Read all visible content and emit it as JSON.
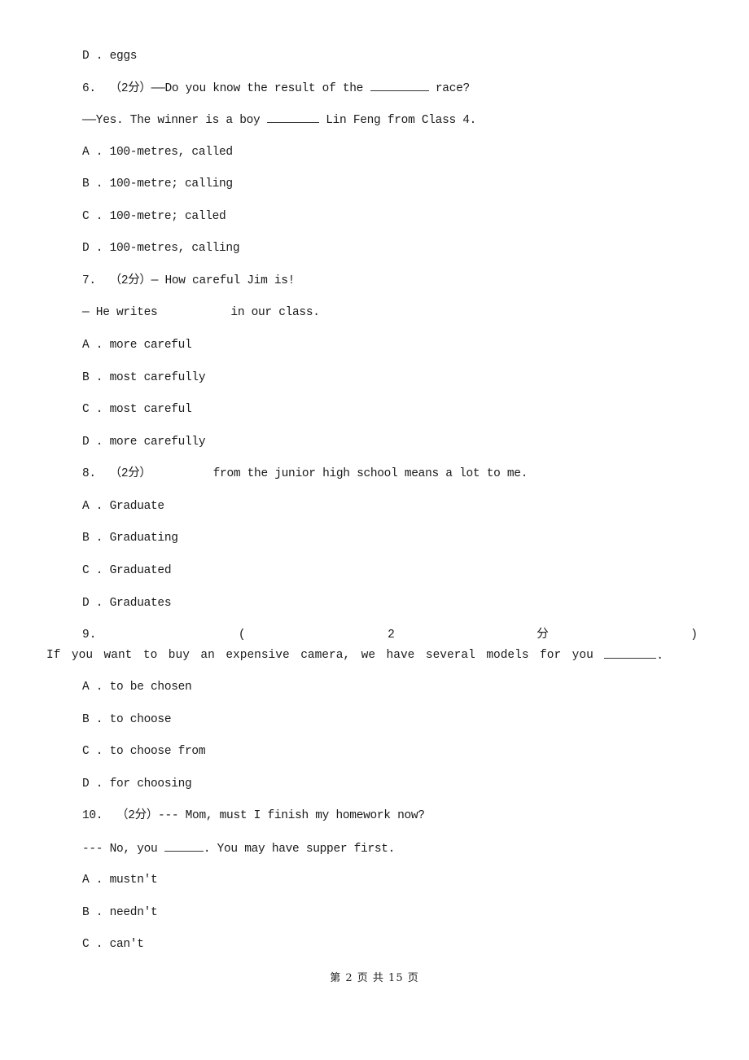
{
  "prev_question_tail": {
    "option_d": "D . eggs"
  },
  "questions": [
    {
      "number": "6.",
      "points": "（2分）",
      "stem_prefix": "——Do you know the result of the",
      "stem_suffix": "race?",
      "line2_prefix": "——Yes. The winner is a boy",
      "line2_suffix": "Lin Feng from Class 4.",
      "options": [
        "A . 100-metres, called",
        "B . 100-metre; calling",
        "C . 100-metre; called",
        "D . 100-metres, calling"
      ]
    },
    {
      "number": "7.",
      "points": "（2分）",
      "stem": "— How careful Jim is!",
      "line2_prefix": "— He writes",
      "line2_suffix": "in our class.",
      "options": [
        "A . more careful",
        "B . most carefully",
        "C . most careful",
        "D . more carefully"
      ]
    },
    {
      "number": "8.",
      "points": "（2分）",
      "stem_suffix": "from the junior high school means a lot to me.",
      "options": [
        "A . Graduate",
        "B . Graduating",
        "C . Graduated",
        "D . Graduates"
      ]
    },
    {
      "number": "9.",
      "points_parts": [
        "(",
        "2",
        "分",
        ")"
      ],
      "stem_words": [
        "If",
        "you",
        "want",
        "to",
        "buy",
        "an",
        "expensive",
        "camera,",
        "we",
        "have",
        "several",
        "models",
        "for",
        "you"
      ],
      "stem_end": ".",
      "options": [
        "A . to be chosen",
        "B . to choose",
        "C . to choose from",
        "D . for choosing"
      ]
    },
    {
      "number": "10.",
      "points": "（2分）",
      "stem": "--- Mom, must I finish my homework now?",
      "line2_prefix": "--- No, you",
      "line2_suffix": ". You may have supper first.",
      "options": [
        "A . mustn't",
        "B . needn't",
        "C . can't"
      ]
    }
  ],
  "footer": {
    "page_label": "第 2 页 共 15 页"
  }
}
